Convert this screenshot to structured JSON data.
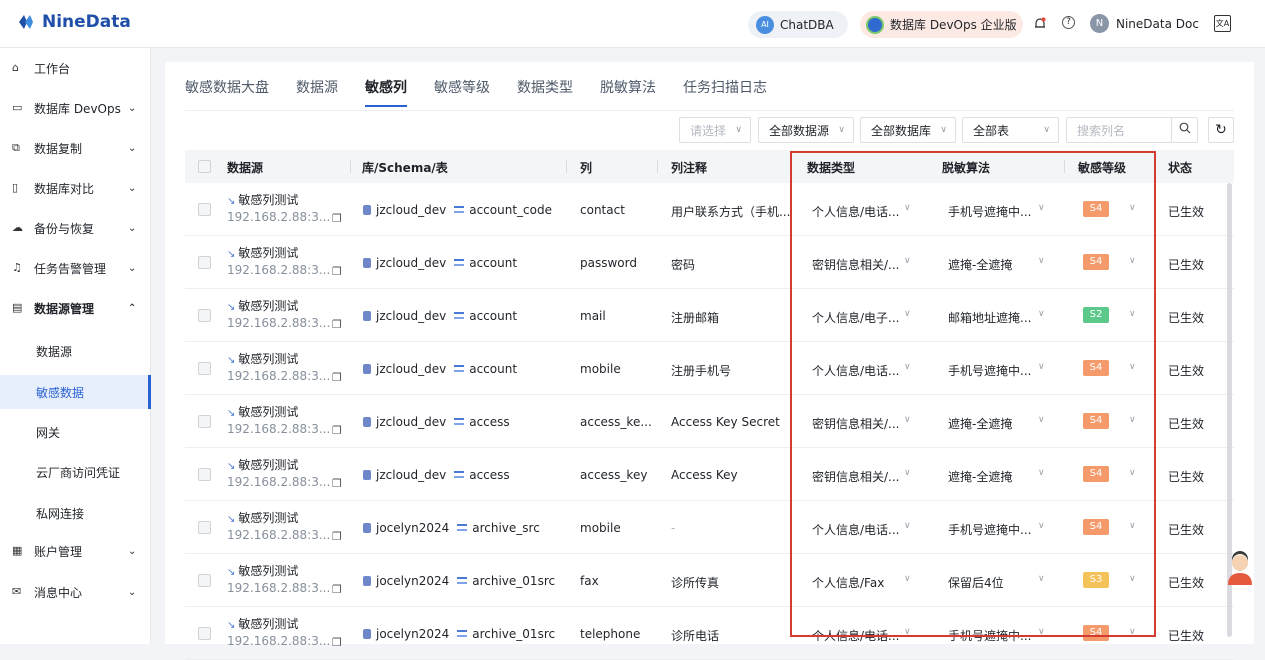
{
  "app": {
    "logo_text": "NineData"
  },
  "topbar": {
    "chatdba": "ChatDBA",
    "ai_badge": "AI",
    "edition": "数据库 DevOps 企业版",
    "user": "NineData Doc",
    "help": "?",
    "lang": "文A"
  },
  "sidebar": {
    "items": [
      {
        "label": "工作台",
        "icon": "home-icon"
      },
      {
        "label": "数据库 DevOps",
        "icon": "devops-icon"
      },
      {
        "label": "数据复制",
        "icon": "replication-icon"
      },
      {
        "label": "数据库对比",
        "icon": "compare-icon"
      },
      {
        "label": "备份与恢复",
        "icon": "backup-icon"
      },
      {
        "label": "任务告警管理",
        "icon": "alarm-icon"
      },
      {
        "label": "数据源管理",
        "icon": "datasource-icon"
      },
      {
        "label": "账户管理",
        "icon": "account-icon"
      },
      {
        "label": "消息中心",
        "icon": "message-icon"
      }
    ],
    "subitems": [
      "数据源",
      "敏感数据",
      "网关",
      "云厂商访问凭证",
      "私网连接"
    ],
    "active_subitem": "敏感数据"
  },
  "tabs": [
    "敏感数据大盘",
    "数据源",
    "敏感列",
    "敏感等级",
    "数据类型",
    "脱敏算法",
    "任务扫描日志"
  ],
  "active_tab": "敏感列",
  "filters": {
    "select_placeholder": "请选择",
    "datasource": "全部数据源",
    "database": "全部数据库",
    "table": "全部表",
    "search_placeholder": "搜索列名"
  },
  "table": {
    "headers": {
      "datasource": "数据源",
      "schema": "库/Schema/表",
      "column": "列",
      "comment": "列注释",
      "type": "数据类型",
      "algorithm": "脱敏算法",
      "level": "敏感等级",
      "status": "状态"
    },
    "rows": [
      {
        "ds": "敏感列测试",
        "host": "192.168.2.88:3...",
        "db": "jzcloud_dev",
        "tbl": "account_code",
        "col": "contact",
        "comment": "用户联系方式（手机...",
        "type": "个人信息/电话...",
        "algo": "手机号遮掩中...",
        "level": "S4",
        "status": "已生效"
      },
      {
        "ds": "敏感列测试",
        "host": "192.168.2.88:3...",
        "db": "jzcloud_dev",
        "tbl": "account",
        "col": "password",
        "comment": "密码",
        "type": "密钥信息相关/...",
        "algo": "遮掩-全遮掩",
        "level": "S4",
        "status": "已生效"
      },
      {
        "ds": "敏感列测试",
        "host": "192.168.2.88:3...",
        "db": "jzcloud_dev",
        "tbl": "account",
        "col": "mail",
        "comment": "注册邮箱",
        "type": "个人信息/电子...",
        "algo": "邮箱地址遮掩...",
        "level": "S2",
        "status": "已生效"
      },
      {
        "ds": "敏感列测试",
        "host": "192.168.2.88:3...",
        "db": "jzcloud_dev",
        "tbl": "account",
        "col": "mobile",
        "comment": "注册手机号",
        "type": "个人信息/电话...",
        "algo": "手机号遮掩中...",
        "level": "S4",
        "status": "已生效"
      },
      {
        "ds": "敏感列测试",
        "host": "192.168.2.88:3...",
        "db": "jzcloud_dev",
        "tbl": "access",
        "col": "access_ke...",
        "comment": "Access Key Secret",
        "type": "密钥信息相关/...",
        "algo": "遮掩-全遮掩",
        "level": "S4",
        "status": "已生效"
      },
      {
        "ds": "敏感列测试",
        "host": "192.168.2.88:3...",
        "db": "jzcloud_dev",
        "tbl": "access",
        "col": "access_key",
        "comment": "Access Key",
        "type": "密钥信息相关/...",
        "algo": "遮掩-全遮掩",
        "level": "S4",
        "status": "已生效"
      },
      {
        "ds": "敏感列测试",
        "host": "192.168.2.88:3...",
        "db": "jocelyn2024",
        "tbl": "archive_src",
        "col": "mobile",
        "comment": "-",
        "type": "个人信息/电话...",
        "algo": "手机号遮掩中...",
        "level": "S4",
        "status": "已生效"
      },
      {
        "ds": "敏感列测试",
        "host": "192.168.2.88:3...",
        "db": "jocelyn2024",
        "tbl": "archive_01src",
        "col": "fax",
        "comment": "诊所传真",
        "type": "个人信息/Fax",
        "algo": "保留后4位",
        "level": "S3",
        "status": "已生效"
      },
      {
        "ds": "敏感列测试",
        "host": "192.168.2.88:3...",
        "db": "jocelyn2024",
        "tbl": "archive_01src",
        "col": "telephone",
        "comment": "诊所电话",
        "type": "个人信息/电话...",
        "algo": "手机号遮掩中...",
        "level": "S4",
        "status": "已生效"
      }
    ]
  },
  "colors": {
    "S4": "#f59a6b",
    "S3": "#f5c25a",
    "S2": "#5cc98a",
    "accent": "#2a62d3",
    "highlight": "#d43c30"
  }
}
